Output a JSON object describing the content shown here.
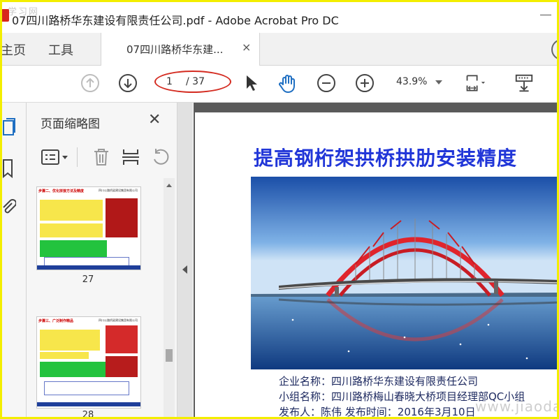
{
  "window": {
    "title": "07四川路桥华东建设有限责任公司.pdf - Adobe Acrobat Pro DC",
    "watermark_top_left": "学习网"
  },
  "tabs": {
    "home": "主页",
    "tools": "工具",
    "document": "07四川路桥华东建...",
    "close_symbol": "×"
  },
  "toolbar": {
    "page_current": "1",
    "page_total": "/ 37",
    "zoom": "43.9%"
  },
  "thumbnails_panel": {
    "title": "页面缩略图",
    "close_symbol": "✕",
    "pages": [
      {
        "number": "27",
        "heading": "步骤二、优化拼接方法及精度",
        "caption": "四川公路桥梁建设集团有限公司"
      },
      {
        "number": "28",
        "heading": "步骤三、广泛制作精品",
        "caption": "四川公路桥梁建设集团有限公司"
      }
    ]
  },
  "document": {
    "headline": "提高钢桁架拱桥拱肋安装精度",
    "company_line": "企业名称：四川路桥华东建设有限责任公司",
    "team_line": "小组名称：四川路桥梅山春晓大桥项目经理部QC小组",
    "publisher_line": "发布人：陈伟     发布时间：2016年3月10日"
  },
  "watermark_bottom_right": "www.jiaodao.com",
  "colors": {
    "accent_red": "#d42b20",
    "headline_blue": "#2136d8",
    "bridge_red": "#e0242c",
    "frame_yellow": "#f3ee00"
  }
}
